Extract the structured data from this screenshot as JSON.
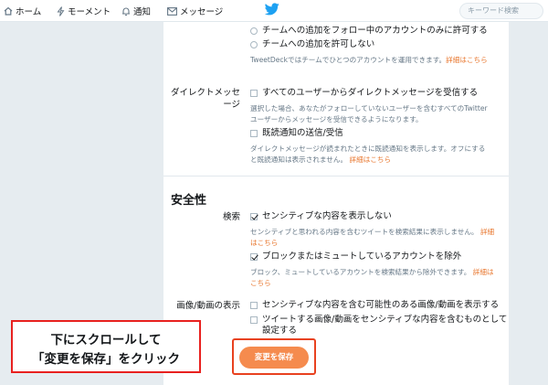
{
  "nav": {
    "home": "ホーム",
    "moments": "モーメント",
    "notifications": "通知",
    "messages": "メッセージ"
  },
  "search": {
    "placeholder": "キーワード検索"
  },
  "team": {
    "option_following": "チームへの追加をフォロー中のアカウントのみに許可する",
    "option_disallow": "チームへの追加を許可しない",
    "help_text": "TweetDeckではチームでひとつのアカウントを運用できます。",
    "help_link": "詳細はこちら"
  },
  "dm": {
    "label_line1": "ダイレクトメッセ",
    "label_line2": "ージ",
    "receive_all": "すべてのユーザーからダイレクトメッセージを受信する",
    "receive_all_help_1": "選択した場合、あなたがフォローしていないユーザーを含むすべてのTwitter",
    "receive_all_help_2": "ユーザーからメッセージを受信できるようになります。",
    "read_receipts": "既読通知の送信/受信",
    "read_receipts_help_1": "ダイレクトメッセージが読まれたときに既読通知を表示します。オフにする",
    "read_receipts_help_2": "と既読通知は表示されません。",
    "read_receipts_link": "詳細はこちら"
  },
  "safety": {
    "title": "安全性",
    "search_label": "検索",
    "hide_sensitive": "センシティブな内容を表示しない",
    "hide_sensitive_help_1": "センシティブと思われる内容を含むツイートを検索結果に表示しません。",
    "hide_sensitive_link_1": "詳細",
    "hide_sensitive_link_2": "はこちら",
    "exclude_blocked": "ブロックまたはミュートしているアカウントを除外",
    "exclude_blocked_help": "ブロック、ミュートしているアカウントを検索結果から除外できます。",
    "exclude_blocked_link_1": "詳細は",
    "exclude_blocked_link_2": "こちら",
    "media_label": "画像/動画の表示",
    "show_sensitive_media": "センシティブな内容を含む可能性のある画像/動画を表示する",
    "mark_media_line1": "ツイートする画像/動画をセンシティブな内容を含むものとして",
    "mark_media_line2": "設定する"
  },
  "save_button": "変更を保存",
  "annotation": {
    "line1": "下にスクロールして",
    "line2": "「変更を保存」をクリック"
  },
  "colors": {
    "accent": "#f58b4e",
    "link": "#e8762d",
    "annotation_border": "#e8211f",
    "twitter_blue": "#1da1f2"
  },
  "icons": [
    "home-icon",
    "bolt-icon",
    "bell-icon",
    "envelope-icon",
    "twitter-bird-icon"
  ]
}
